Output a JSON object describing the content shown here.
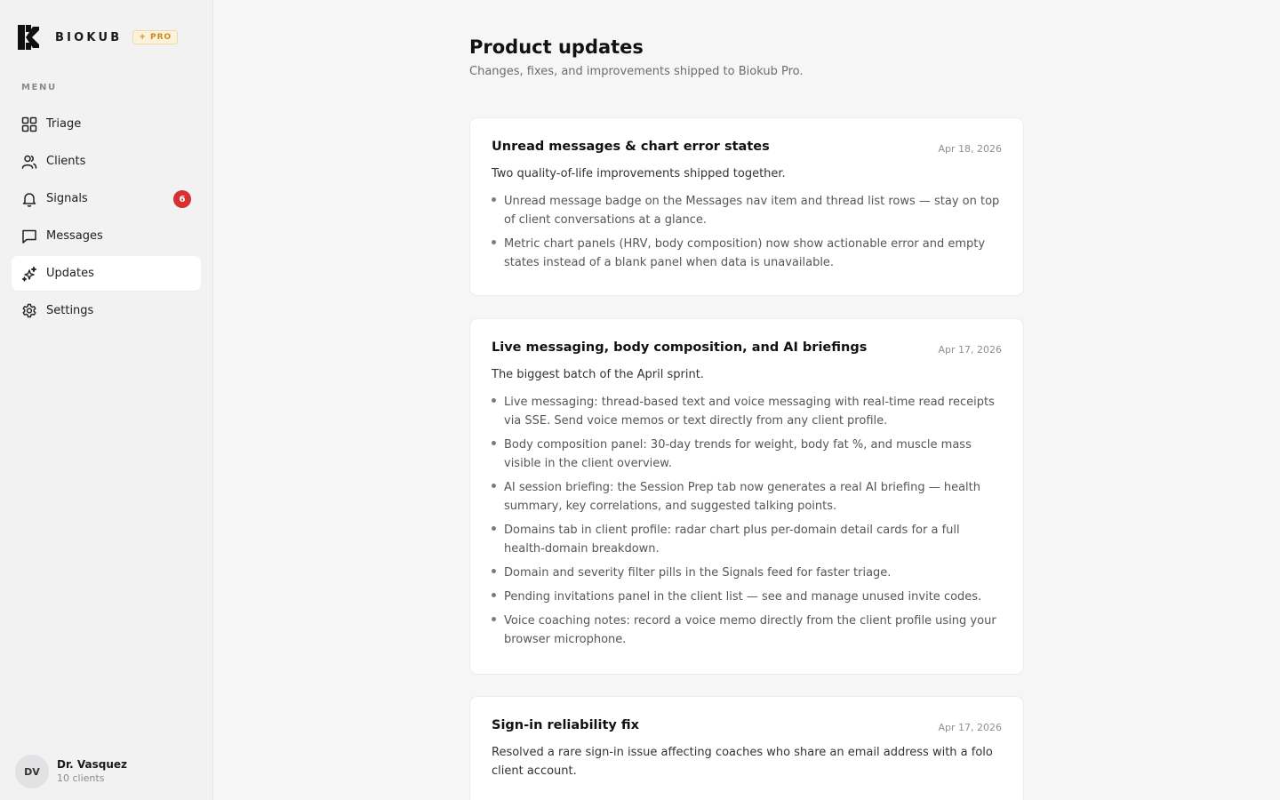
{
  "brand": {
    "name": "BIOKUB",
    "badge": "+ PRO"
  },
  "sidebar": {
    "heading": "MENU",
    "items": [
      {
        "label": "Triage",
        "icon": "grid-icon"
      },
      {
        "label": "Clients",
        "icon": "users-icon"
      },
      {
        "label": "Signals",
        "icon": "bell-icon",
        "badge": "6"
      },
      {
        "label": "Messages",
        "icon": "message-icon"
      },
      {
        "label": "Updates",
        "icon": "sparkles-icon",
        "active": true
      },
      {
        "label": "Settings",
        "icon": "gear-icon"
      }
    ]
  },
  "user": {
    "initials": "DV",
    "name": "Dr. Vasquez",
    "subtitle": "10 clients"
  },
  "page": {
    "title": "Product updates",
    "subtitle": "Changes, fixes, and improvements shipped to Biokub Pro."
  },
  "updates": [
    {
      "title": "Unread messages & chart error states",
      "date": "Apr 18, 2026",
      "description": "Two quality-of-life improvements shipped together.",
      "items": [
        "Unread message badge on the Messages nav item and thread list rows — stay on top of client conversations at a glance.",
        "Metric chart panels (HRV, body composition) now show actionable error and empty states instead of a blank panel when data is unavailable."
      ]
    },
    {
      "title": "Live messaging, body composition, and AI briefings",
      "date": "Apr 17, 2026",
      "description": "The biggest batch of the April sprint.",
      "items": [
        "Live messaging: thread-based text and voice messaging with real-time read receipts via SSE. Send voice memos or text directly from any client profile.",
        "Body composition panel: 30-day trends for weight, body fat %, and muscle mass visible in the client overview.",
        "AI session briefing: the Session Prep tab now generates a real AI briefing — health summary, key correlations, and suggested talking points.",
        "Domains tab in client profile: radar chart plus per-domain detail cards for a full health-domain breakdown.",
        "Domain and severity filter pills in the Signals feed for faster triage.",
        "Pending invitations panel in the client list — see and manage unused invite codes.",
        "Voice coaching notes: record a voice memo directly from the client profile using your browser microphone."
      ]
    },
    {
      "title": "Sign-in reliability fix",
      "date": "Apr 17, 2026",
      "description": "Resolved a rare sign-in issue affecting coaches who share an email address with a folo client account.",
      "items": []
    }
  ],
  "colors": {
    "accent_badge": "#d63031",
    "pro_badge": "#c98a1c",
    "active_bg": "#ffffff"
  }
}
